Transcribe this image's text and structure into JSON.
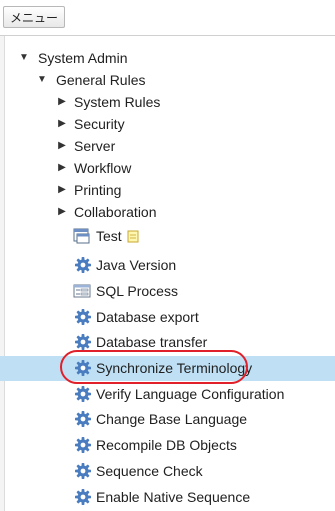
{
  "topbar": {
    "menu_label": "メニュー"
  },
  "tree": {
    "root": {
      "label": "System Admin",
      "expanded": true
    },
    "general": {
      "label": "General Rules",
      "expanded": true
    },
    "folders": [
      {
        "label": "System Rules",
        "expanded": false
      },
      {
        "label": "Security",
        "expanded": false
      },
      {
        "label": "Server",
        "expanded": false
      },
      {
        "label": "Workflow",
        "expanded": false
      },
      {
        "label": "Printing",
        "expanded": false
      },
      {
        "label": "Collaboration",
        "expanded": false
      }
    ],
    "items": [
      {
        "label": "Test",
        "icon": "window-icon",
        "badge_icon": "note-icon"
      },
      {
        "label": "Java Version",
        "icon": "gear-icon"
      },
      {
        "label": "SQL Process",
        "icon": "form-icon"
      },
      {
        "label": "Database export",
        "icon": "gear-icon"
      },
      {
        "label": "Database transfer",
        "icon": "gear-icon"
      },
      {
        "label": "Synchronize Terminology",
        "icon": "gear-icon",
        "selected": true
      },
      {
        "label": "Verify Language Configuration",
        "icon": "gear-icon"
      },
      {
        "label": "Change Base Language",
        "icon": "gear-icon"
      },
      {
        "label": "Recompile DB Objects",
        "icon": "gear-icon"
      },
      {
        "label": "Sequence Check",
        "icon": "gear-icon"
      },
      {
        "label": "Enable Native Sequence",
        "icon": "gear-icon"
      }
    ]
  },
  "colors": {
    "selection": "#bfe0f4",
    "annotation_oval": "#e0202a",
    "gear": "#4a7cc0"
  }
}
